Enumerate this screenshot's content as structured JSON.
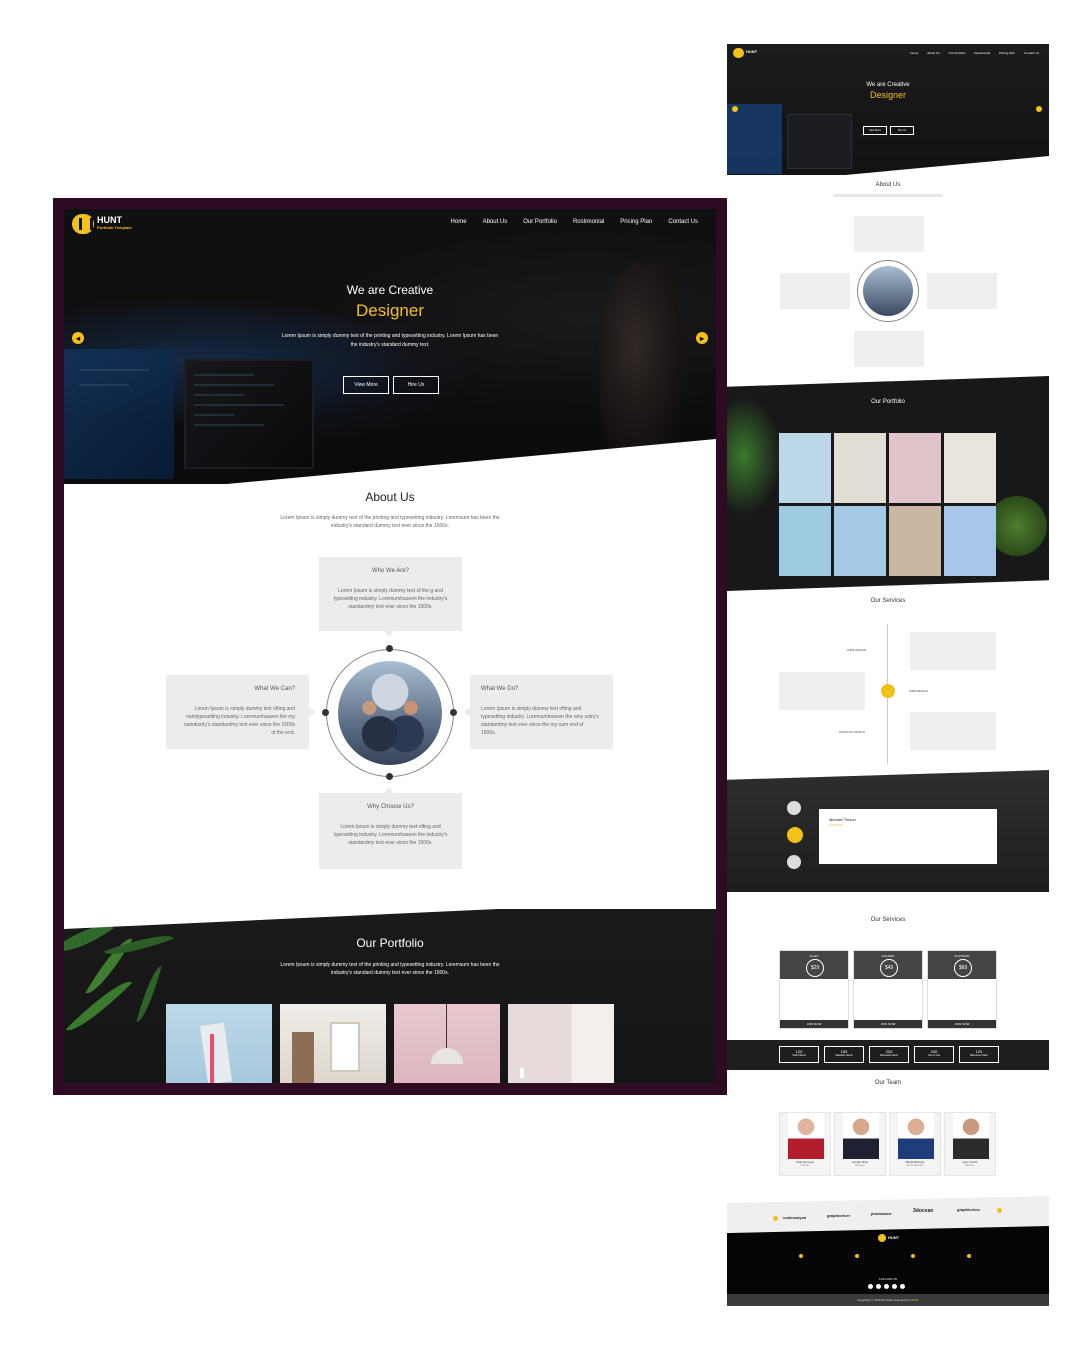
{
  "colors": {
    "accent": "#f2c21b",
    "frame": "#2e0b22",
    "dark": "#151515",
    "card": "#ececec"
  },
  "brand": {
    "name": "HUNT",
    "tagline": "Portfolio Template"
  },
  "nav": {
    "items": [
      "Home",
      "About Us",
      "Our Portfolio",
      "Rostimonial",
      "Pricing Plan",
      "Contact Us"
    ]
  },
  "hero": {
    "subtitle": "We are Creative",
    "title": "Designer",
    "text": "Lorem Ipsum is simply dummy text of the printing and typesetting industry. Lorem Ipsum has been the industry's standard dummy text.",
    "view_more": "View More",
    "hire_us": "Hire Us",
    "prev_icon": "arrow-left-icon",
    "next_icon": "arrow-right-icon"
  },
  "about": {
    "title": "About Us",
    "desc": "Lorem Ipsum is simply dummy text of the printing and typesetting industry. Loremsum has been the industry's standard dummy text ever since the 1500s.",
    "who": {
      "title": "Who We Are?",
      "text": "Lorem Ipsum is simply dummy text of the g and typesetting industry. Loremumhaseen the industry's standardmy text ever since the 1500s."
    },
    "can": {
      "title": "What We Can?",
      "text": "Lorem Ipsum is simply dummy text ofting and naintypesetting industry. Loremumhaseen the my naindustry's standardmy text ever since the 1500s of the end."
    },
    "do": {
      "title": "What We Do?",
      "text": "Lorem Ipsum is simply dummy text ofting and typesetting industry. Loremumhaseen the nmy ustry's standardmy text ever since the my nam end of 1500s."
    },
    "why": {
      "title": "Why Choose Us?",
      "text": "Lorem Ipsum is simply dummy text ofting and typesetting industry. Loremumhaseen the industry's standardmy text ever since the 1500s."
    }
  },
  "portfolio": {
    "title": "Our Portfolio",
    "desc": "Lorem Ipsum is simply dummy text of the printing and typesetting industry. Loremsum has been the industry's standard dummy text ever since the 1500s."
  },
  "preview": {
    "about_title": "About Us",
    "portfolio_title": "Our Portfolio",
    "services_title": "Our Services",
    "services": [
      "WEB DESIGN",
      "WEB DESIGN",
      "GRAPHIC DESIGN"
    ],
    "testimonial_name": "Michael Tinson",
    "testimonial_stars": "★★★★★",
    "pricing_title": "Our Services",
    "pricing": [
      {
        "name": "ALLEY",
        "price": "$29",
        "cta": "JOIN NOW"
      },
      {
        "name": "GOLDEN",
        "price": "$49",
        "cta": "JOIN NOW"
      },
      {
        "name": "PLATINUM",
        "price": "$69",
        "cta": "JOIN NOW"
      }
    ],
    "stats": [
      {
        "n": "120",
        "l": "Total Clients"
      },
      {
        "n": "150",
        "l": "Satisfied clients"
      },
      {
        "n": "220",
        "l": "Reviewed Client"
      },
      {
        "n": "430",
        "l": "Cup of Tea"
      },
      {
        "n": "120",
        "l": "Milestone Client"
      }
    ],
    "team_title": "Our Team",
    "team": [
      {
        "name": "Antonia Hope",
        "role": "Founder"
      },
      {
        "name": "Jeruan Bros",
        "role": "Designer"
      },
      {
        "name": "Maria Bohnan",
        "role": "Senior Member"
      },
      {
        "name": "Jeen Smith",
        "role": "Member"
      }
    ],
    "brands": [
      "codecanyon",
      "graphicriver",
      "photodune",
      "3docean",
      "graphicriver"
    ],
    "follow": "FOLLOW US",
    "copyright": "Copyright © 2019 All rights reserved by ",
    "copyright_brand": "HUNT"
  }
}
